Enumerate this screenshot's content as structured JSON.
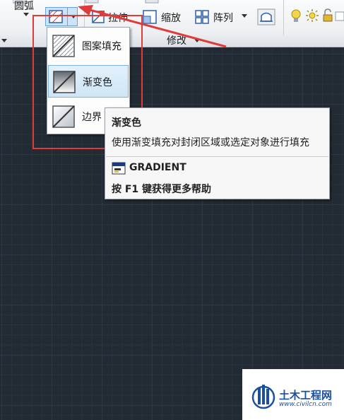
{
  "ribbon": {
    "arc_label": "圆弧",
    "stretch_label": "拉伸",
    "scale_label": "缩放",
    "array_label": "阵列",
    "modify_panel_label": "修改"
  },
  "hatch_menu": {
    "items": [
      {
        "label": "图案填充",
        "icon": "hatch-icon"
      },
      {
        "label": "渐变色",
        "icon": "gradient-icon",
        "selected": true
      },
      {
        "label": "边界",
        "icon": "boundary-icon"
      }
    ]
  },
  "tooltip": {
    "title": "渐变色",
    "description": "使用渐变填充对封闭区域或选定对象进行填充",
    "command": "GRADIENT",
    "help": "按 F1 键获得更多帮助"
  },
  "watermark": {
    "name": "土木工程网",
    "url": "www.civilcn.com"
  },
  "colors": {
    "canvas": "#222a33",
    "annotation_red": "#e03b3b",
    "selection_blue": "#cfe6f7",
    "watermark_blue": "#1b4fa0"
  }
}
